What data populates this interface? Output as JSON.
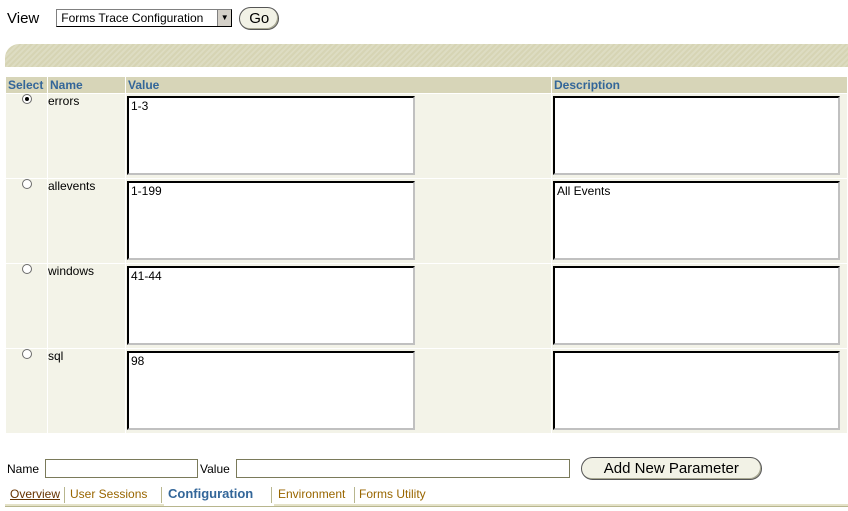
{
  "view": {
    "label": "View",
    "selected": "Forms Trace Configuration",
    "go_label": "Go"
  },
  "table": {
    "headers": {
      "select": "Select",
      "name": "Name",
      "value": "Value",
      "description": "Description"
    },
    "rows": [
      {
        "name": "errors",
        "value": "1-3",
        "description": "",
        "selected": true
      },
      {
        "name": "allevents",
        "value": "1-199",
        "description": "All Events",
        "selected": false
      },
      {
        "name": "windows",
        "value": "41-44",
        "description": "",
        "selected": false
      },
      {
        "name": "sql",
        "value": "98",
        "description": "",
        "selected": false
      }
    ]
  },
  "add": {
    "name_label": "Name",
    "name_value": "",
    "value_label": "Value",
    "value_value": "",
    "button_label": "Add New Parameter"
  },
  "tabs": {
    "overview": "Overview",
    "user_sessions": "User Sessions",
    "configuration": "Configuration",
    "environment": "Environment",
    "forms_utility": "Forms Utility"
  }
}
